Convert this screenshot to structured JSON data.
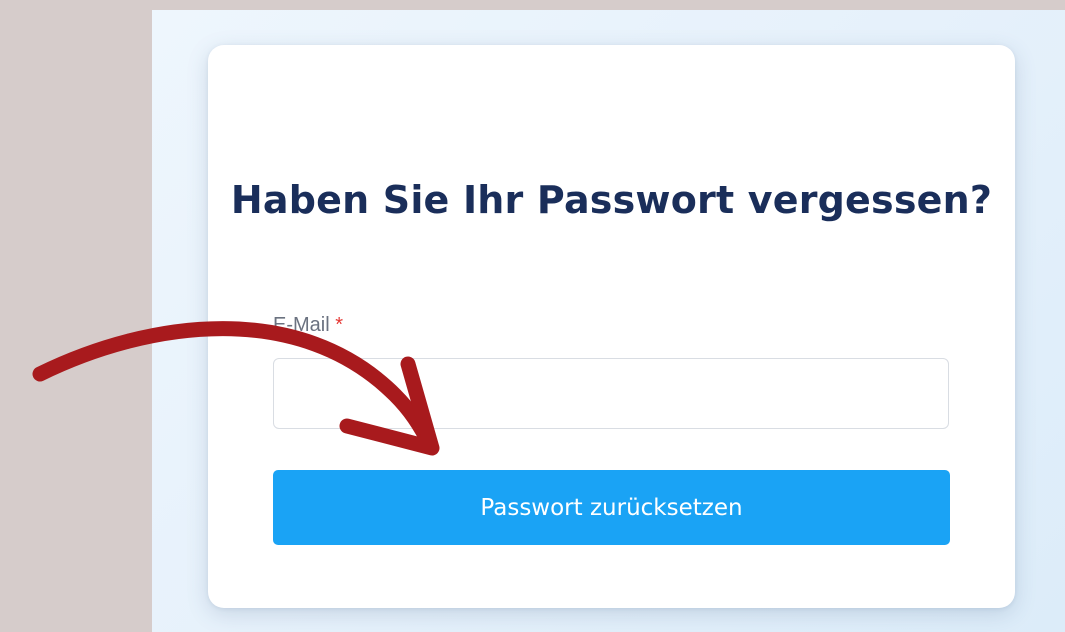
{
  "form": {
    "title": "Haben Sie Ihr Passwort vergessen?",
    "email_label": "E-Mail",
    "required_marker": "*",
    "email_value": "",
    "email_placeholder": "",
    "submit_label": "Passwort zurücksetzen"
  },
  "colors": {
    "title": "#1a2e5a",
    "button": "#1aa3f5",
    "required": "#e53935",
    "annotation_arrow": "#a81a1d"
  },
  "icons": {
    "annotation": "curved-arrow-icon"
  }
}
